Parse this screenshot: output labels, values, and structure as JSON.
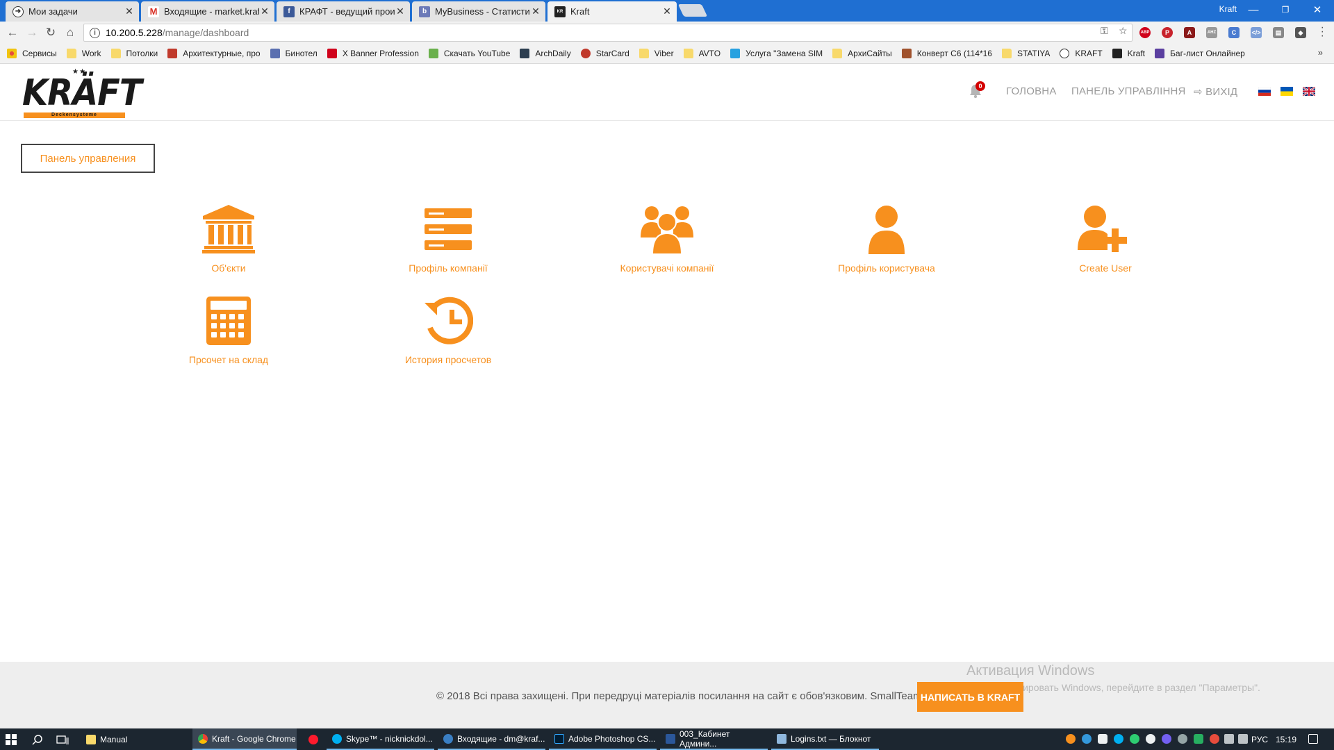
{
  "browser": {
    "tabs": [
      {
        "title": "Мои задачи",
        "icon": "task-icon"
      },
      {
        "title": "Входящие - market.kraft",
        "icon": "gmail-icon"
      },
      {
        "title": "КРАФТ - ведущий произ",
        "icon": "facebook-icon"
      },
      {
        "title": "MyBusiness - Статистика",
        "icon": "mybusiness-icon"
      },
      {
        "title": "Kraft",
        "icon": "kraft-icon"
      }
    ],
    "window_user": "Kraft",
    "url_host": "10.200.5.228",
    "url_path": "/manage/dashboard",
    "bookmarks": [
      "Сервисы",
      "Work",
      "Потолки",
      "Архитектурные, про",
      "Бинотел",
      "X Banner Profession",
      "Скачать YouTube",
      "ArchDaily",
      "StarCard",
      "Viber",
      "AVTO",
      "Услуга \"Замена SIM",
      "АрхиСайты",
      "Конверт C6 (114*16",
      "STATIYA",
      "KRAFT",
      "Kraft",
      "Баг-лист Онлайнер"
    ],
    "bookmarks_more": "»"
  },
  "header": {
    "logo_text": "KRÄFT",
    "logo_sub": "Deckensysteme",
    "logo_stars": "★★",
    "notifications_count": "0",
    "nav": {
      "home": "ГОЛОВНА",
      "panel": "ПАНЕЛЬ УПРАВЛІННЯ",
      "logout": "ВИХІД"
    },
    "languages": [
      "ru",
      "ua",
      "en"
    ]
  },
  "main": {
    "panel_button": "Панель управления",
    "tiles": [
      {
        "label": "Об'єкти",
        "icon": "building-icon"
      },
      {
        "label": "Профіль компанії",
        "icon": "server-icon"
      },
      {
        "label": "Користувачі компанії",
        "icon": "users-icon"
      },
      {
        "label": "Профіль користувача",
        "icon": "user-icon"
      },
      {
        "label": "Create User",
        "icon": "user-plus-icon"
      },
      {
        "label": "Прсочет на склад",
        "icon": "calculator-icon"
      },
      {
        "label": "История просчетов",
        "icon": "history-icon"
      }
    ],
    "accent_color": "#f7901e"
  },
  "footer": {
    "copyright": "© 2018 Всі права захищені. При передруці матеріалів посилання на сайт є обов'язковим. SmallTeam",
    "write_button": "НАПИСАТЬ В KRAFT",
    "activation_title": "Активация Windows",
    "activation_text": "Чтобы активировать Windows, перейдите в раздел \"Параметры\"."
  },
  "taskbar": {
    "apps": [
      {
        "title": "Manual"
      },
      {
        "title": "Kraft - Google Chrome"
      },
      {
        "title": ""
      },
      {
        "title": "Skype™ - nicknickdol..."
      },
      {
        "title": "Входящие - dm@kraf..."
      },
      {
        "title": "Adobe Photoshop CS..."
      },
      {
        "title": "003_Кабинет Админи..."
      },
      {
        "title": "Logins.txt — Блокнот"
      }
    ],
    "lang": "РУС",
    "time": "15:19"
  }
}
